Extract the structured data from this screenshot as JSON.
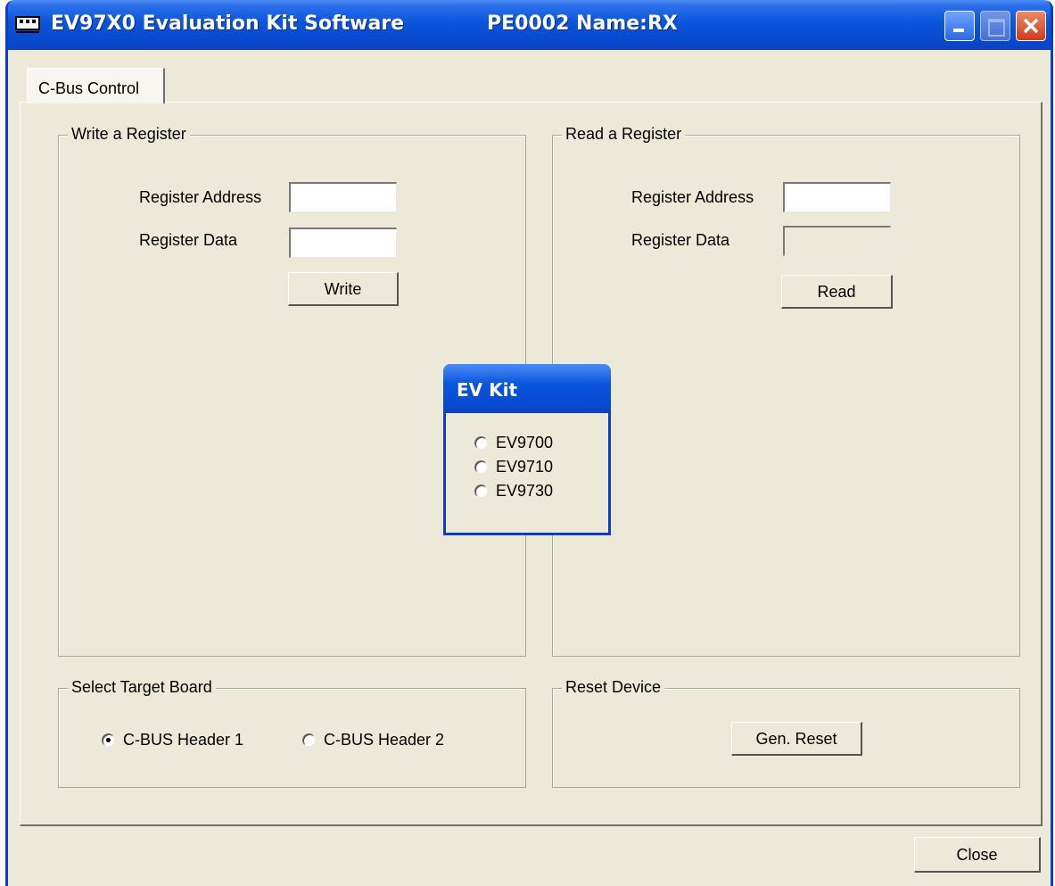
{
  "window": {
    "title": "EV97X0 Evaluation Kit Software",
    "subtitle": "PE0002 Name:RX"
  },
  "tabs": [
    {
      "label": "C-Bus Control",
      "active": true
    }
  ],
  "write_group": {
    "legend": "Write a Register",
    "address_label": "Register Address",
    "address_value": "",
    "data_label": "Register Data",
    "data_value": "",
    "button": "Write"
  },
  "read_group": {
    "legend": "Read a Register",
    "address_label": "Register Address",
    "address_value": "",
    "data_label": "Register Data",
    "data_value": "",
    "button": "Read"
  },
  "target_group": {
    "legend": "Select Target Board",
    "options": [
      {
        "label": "C-BUS Header 1",
        "selected": true
      },
      {
        "label": "C-BUS Header 2",
        "selected": false
      }
    ]
  },
  "reset_group": {
    "legend": "Reset Device",
    "button": "Gen. Reset"
  },
  "popup": {
    "title": "EV Kit",
    "options": [
      {
        "label": "EV9700",
        "selected": false
      },
      {
        "label": "EV9710",
        "selected": false
      },
      {
        "label": "EV9730",
        "selected": false
      }
    ]
  },
  "close_button": "Close",
  "colors": {
    "titlebar": "#0a55dc",
    "face": "#ece9d8"
  }
}
